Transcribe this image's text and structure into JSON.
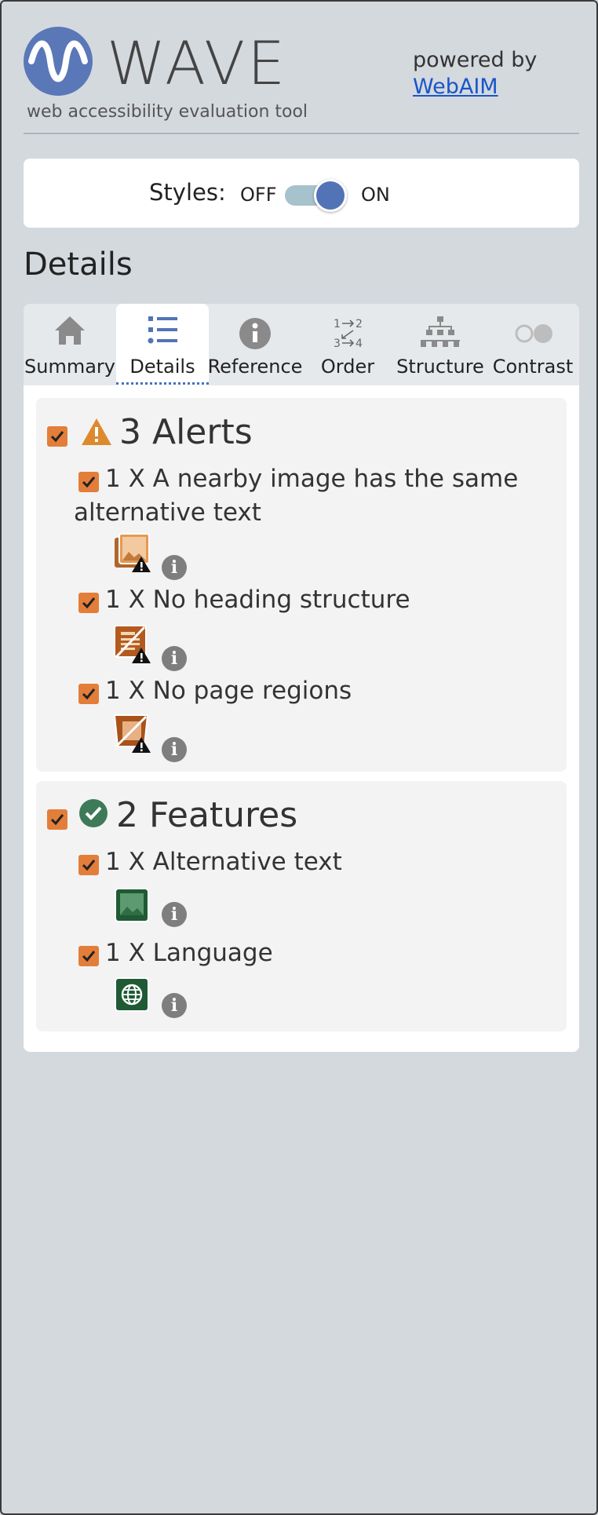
{
  "header": {
    "logo_text": "WAVE",
    "tagline": "web accessibility evaluation tool",
    "powered_by": "powered by",
    "webaim_link": "WebAIM"
  },
  "styles_toggle": {
    "label": "Styles:",
    "off": "OFF",
    "on": "ON",
    "state": "on",
    "track_color": "#a6c2cc",
    "knob_color": "#5273b6"
  },
  "section_title": "Details",
  "tabs": [
    {
      "label": "Summary",
      "icon": "home-icon",
      "active": false
    },
    {
      "label": "Details",
      "icon": "list-icon",
      "active": true
    },
    {
      "label": "Reference",
      "icon": "info-icon",
      "active": false
    },
    {
      "label": "Order",
      "icon": "order-icon",
      "active": false
    },
    {
      "label": "Structure",
      "icon": "structure-icon",
      "active": false
    },
    {
      "label": "Contrast",
      "icon": "contrast-icon",
      "active": false
    }
  ],
  "alerts": {
    "title": "3 Alerts",
    "checked": true,
    "items": [
      {
        "text_line1": "1 X A nearby image has the same",
        "text_line2": "alternative text",
        "icon": "redundant-alt-alert-icon",
        "checked": true
      },
      {
        "text_line1": "1 X No heading structure",
        "icon": "no-heading-alert-icon",
        "checked": true
      },
      {
        "text_line1": "1 X No page regions",
        "icon": "no-regions-alert-icon",
        "checked": true
      }
    ]
  },
  "features": {
    "title": "2 Features",
    "checked": true,
    "items": [
      {
        "text_line1": "1 X Alternative text",
        "icon": "alt-text-feature-icon",
        "checked": true
      },
      {
        "text_line1": "1 X Language",
        "icon": "language-feature-icon",
        "checked": true
      }
    ]
  },
  "colors": {
    "checkbox": "#e37e3a",
    "accent_blue": "#4a6fc0",
    "alert_orange": "#dd8a2e",
    "feature_green": "#3e7a58"
  }
}
